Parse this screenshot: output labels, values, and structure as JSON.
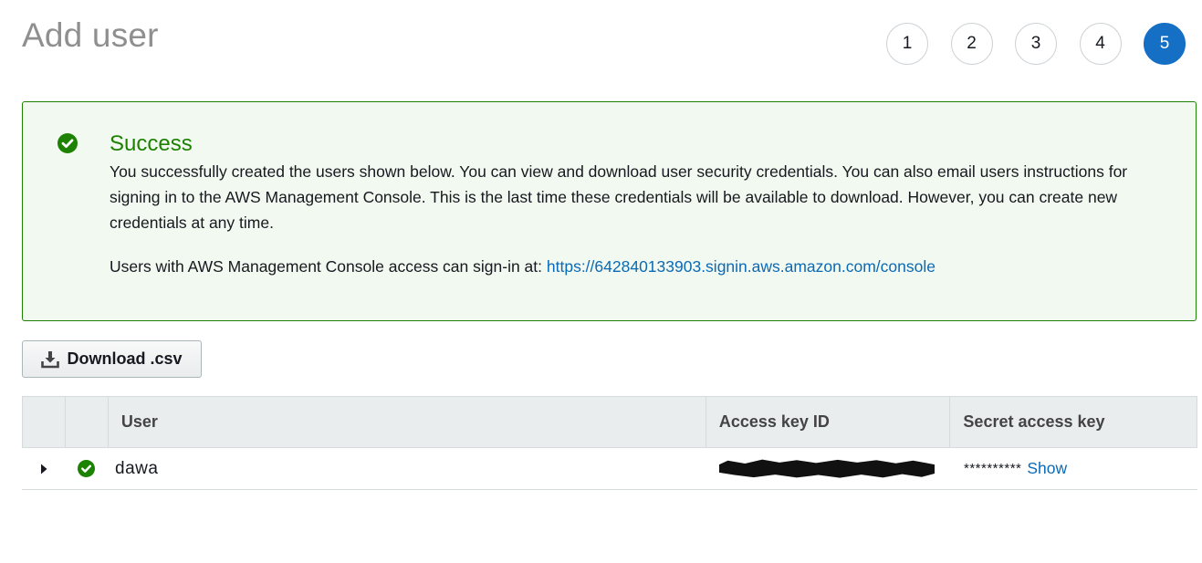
{
  "page": {
    "title": "Add user"
  },
  "steps": [
    "1",
    "2",
    "3",
    "4",
    "5"
  ],
  "active_step": "5",
  "alert": {
    "title": "Success",
    "body": "You successfully created the users shown below. You can view and download user security credentials. You can also email users instructions for signing in to the AWS Management Console. This is the last time these credentials will be available to download. However, you can create new credentials at any time.",
    "signin_text": "Users with AWS Management Console access can sign-in at: ",
    "signin_url": "https://642840133903.signin.aws.amazon.com/console"
  },
  "download_button": {
    "label": "Download .csv"
  },
  "table": {
    "columns": [
      "User",
      "Access key ID",
      "Secret access key"
    ],
    "rows": [
      {
        "user": "dawa",
        "status": "success",
        "access_key_id": "",
        "secret_mask": "**********",
        "secret_action": "Show"
      }
    ]
  },
  "colors": {
    "success": "#1d8102",
    "active_step": "#156fc4",
    "link": "#0b6ab5"
  },
  "icons": {
    "alert": "check-circle-icon",
    "download": "download-icon",
    "expand": "caret-right-icon",
    "row_status": "check-circle-icon"
  }
}
